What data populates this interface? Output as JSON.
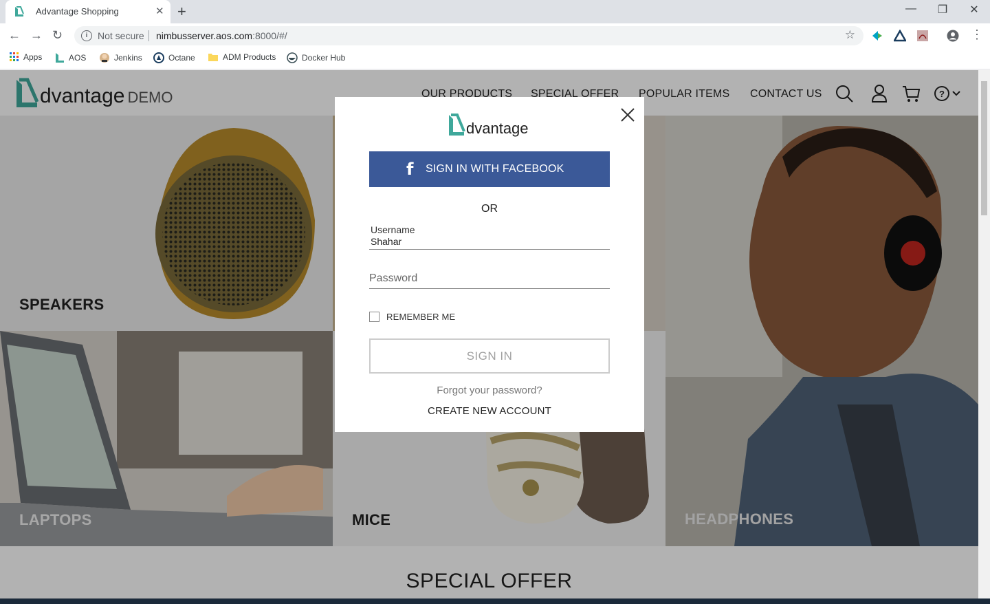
{
  "browser": {
    "tab_title": "Advantage Shopping",
    "tab_close": "✕",
    "new_tab": "+",
    "not_secure": "Not secure",
    "url_host": "nimbusserver.aos.com",
    "url_rest": ":8000/#/",
    "bookmarks": [
      "Apps",
      "AOS",
      "Jenkins",
      "Octane",
      "ADM Products",
      "Docker Hub"
    ]
  },
  "site": {
    "logo_word": "dvantage",
    "logo_demo": "DEMO",
    "menu": [
      "OUR PRODUCTS",
      "SPECIAL OFFER",
      "POPULAR ITEMS",
      "CONTACT US"
    ],
    "categories": [
      "SPEAKERS",
      "LAPTOPS",
      "MICE",
      "HEADPHONES"
    ],
    "special_offer_heading": "SPECIAL OFFER"
  },
  "login": {
    "logo_word": "dvantage",
    "facebook_label": "SIGN IN WITH FACEBOOK",
    "or_text": "OR",
    "username_label": "Username",
    "username_value": "Shahar",
    "password_placeholder": "Password",
    "remember_me": "REMEMBER ME",
    "remember_checked": false,
    "signin_label": "SIGN IN",
    "forgot_password": "Forgot your password?",
    "create_account": "CREATE NEW ACCOUNT"
  },
  "colors": {
    "brand_green": "#3fa89b",
    "facebook_blue": "#3b5998",
    "overlay": "rgba(0,0,0,0.30)"
  }
}
